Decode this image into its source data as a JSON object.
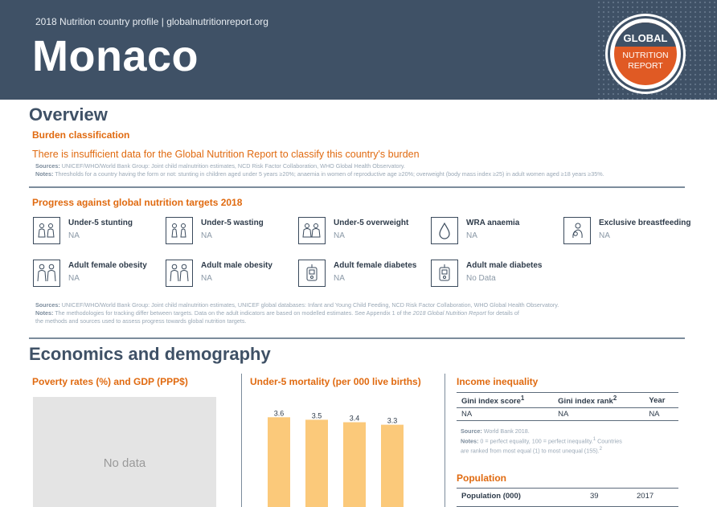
{
  "header": {
    "subtitle": "2018 Nutrition country profile  |  globalnutritionreport.org",
    "country": "Monaco",
    "logo": {
      "line1": "GLOBAL",
      "line2": "NUTRITION",
      "line3": "REPORT"
    }
  },
  "overview": {
    "title": "Overview",
    "burden_heading": "Burden classification",
    "burden_text": "There is insufficient data for the Global Nutrition Report to classify this country's burden",
    "sources_label": "Sources:",
    "sources_text": "UNICEF/WHO/World Bank Group: Joint child malnutrition estimates, NCD Risk Factor Collaboration, WHO Global Health Observatory.",
    "notes_label": "Notes:",
    "notes_text": "Thresholds for a country having the form or not: stunting in children aged under 5 years ≥20%; anaemia in women of reproductive age ≥20%; overweight (body mass index ≥25) in adult women aged ≥18 years ≥35%."
  },
  "progress": {
    "heading": "Progress against global nutrition targets 2018",
    "targets": [
      {
        "name": "Under-5 stunting",
        "value": "NA",
        "icon": "children-icon"
      },
      {
        "name": "Under-5 wasting",
        "value": "NA",
        "icon": "children-icon"
      },
      {
        "name": "Under-5 overweight",
        "value": "NA",
        "icon": "children-icon"
      },
      {
        "name": "WRA anaemia",
        "value": "NA",
        "icon": "blood-drop-icon"
      },
      {
        "name": "Exclusive breastfeeding",
        "value": "NA",
        "icon": "breastfeeding-icon"
      },
      {
        "name": "Adult female obesity",
        "value": "NA",
        "icon": "adults-icon"
      },
      {
        "name": "Adult male obesity",
        "value": "NA",
        "icon": "adults-icon"
      },
      {
        "name": "Adult female diabetes",
        "value": "NA",
        "icon": "glucose-meter-icon"
      },
      {
        "name": "Adult male diabetes",
        "value": "No Data",
        "icon": "glucose-meter-icon"
      }
    ],
    "sources_label": "Sources:",
    "sources_text": "UNICEF/WHO/World Bank Group: Joint child malnutrition estimates, UNICEF global databases: Infant and Young Child Feeding, NCD Risk Factor Collaboration, WHO Global Health Observatory.",
    "notes_label": "Notes:",
    "notes_text1": "The methodologies for tracking differ between targets. Data on the adult indicators are based on modelled estimates. See Appendix 1 of the ",
    "notes_italic": "2018 Global Nutrition Report",
    "notes_text2": " for details of",
    "notes_text3": "the methods and sources used to assess progress towards global nutrition targets."
  },
  "economics": {
    "title": "Economics and demography",
    "poverty_heading": "Poverty rates (%) and GDP (PPP$)",
    "no_data": "No data",
    "mortality_heading": "Under-5 mortality (per 000 live births)",
    "income_heading": "Income inequality",
    "income_table": {
      "headers": [
        "Gini index score",
        "Gini index rank",
        "Year"
      ],
      "header_sups": [
        "1",
        "2",
        ""
      ],
      "row": [
        "NA",
        "NA",
        "NA"
      ]
    },
    "income_source_label": "Source:",
    "income_source_text": "World Bank 2018.",
    "income_notes_label": "Notes:",
    "income_notes_text1": "0 = perfect equality, 100 = perfect inequality.",
    "income_notes_sup1": "1",
    "income_notes_text2": "Countries",
    "income_notes_text3": "are ranked from most equal (1) to most unequal (155).",
    "income_notes_sup2": "2",
    "population_heading": "Population",
    "population_row": {
      "label": "Population (000)",
      "value": "39",
      "year": "2017"
    }
  },
  "chart_data": {
    "type": "bar",
    "title": "Under-5 mortality (per 000 live births)",
    "values": [
      3.6,
      3.5,
      3.4,
      3.3
    ],
    "data_labels": [
      "3.6",
      "3.5",
      "3.4",
      "3.3"
    ],
    "color": "#fbc97a",
    "ylim": [
      0,
      3.9
    ]
  },
  "colors": {
    "header": "#3f5166",
    "accent": "#e06a10",
    "bar": "#fbc97a"
  }
}
